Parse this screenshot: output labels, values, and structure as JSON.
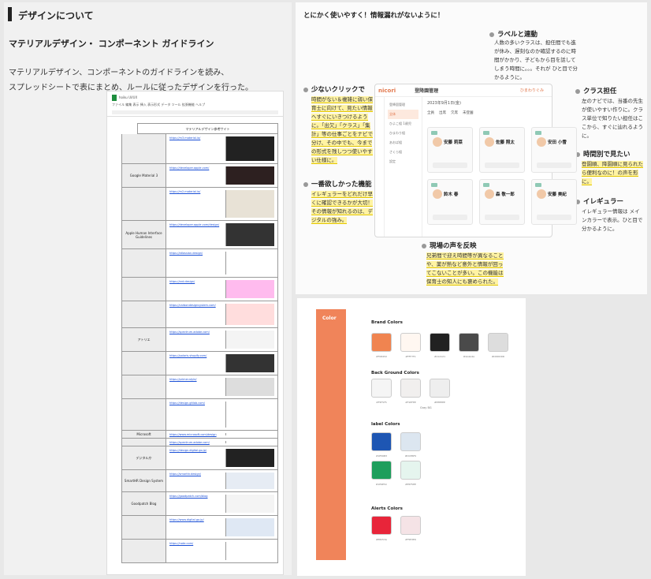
{
  "left": {
    "section_title": "デザインについて",
    "subtitle": "マテリアルデザイン・ コンポーネント ガイドライン",
    "desc_line1": "マテリアルデザイン、コンポーネントのガイドラインを読み、",
    "desc_line2": "スプレッドシートで表にまとめ、ルールに従ったデザインを行った。",
    "sheet": {
      "file_title": "hoiku UI/UX",
      "menu": "ファイル 編集 表示 挿入 表示形式 データ ツール 拡張機能 ヘルプ",
      "header": "マテリアルデザイン参考サイト",
      "rows": [
        {
          "cat": "",
          "link": "https://m3.material.io/"
        },
        {
          "cat": "Google Material 3",
          "link": "https://developer.apple.com/"
        },
        {
          "cat": "",
          "link": "https://m2.material.io/"
        },
        {
          "cat": "Apple Human Interface Guidelines",
          "link": "https://developer.apple.com/design/"
        },
        {
          "cat": "",
          "link": "https://atlassian.design/"
        },
        {
          "cat": "",
          "link": "https://ant.design/"
        },
        {
          "cat": "",
          "link": "https://carbondesignsystem.com/"
        },
        {
          "cat": "アトリエ",
          "link": "https://spectrum.adobe.com/"
        },
        {
          "cat": "",
          "link": "https://polaris.shopify.com/"
        },
        {
          "cat": "",
          "link": "https://primer.style/"
        },
        {
          "cat": "",
          "link": "https://design.gitlab.com/"
        },
        {
          "cat": "Microsoft",
          "link": "https://www.microsoft.com/design"
        },
        {
          "cat": "",
          "link": "https://spectrum.adobe.com/"
        },
        {
          "cat": "デジタル庁",
          "link": "https://design.digital.go.jp/"
        },
        {
          "cat": "SmartHR Design System",
          "link": "https://smarthr.design/"
        },
        {
          "cat": "Goodpatch Blog",
          "link": "https://goodpatch.com/blog"
        },
        {
          "cat": "",
          "link": "https://www.digital.go.jp/"
        },
        {
          "cat": "",
          "link": "https://note.com/"
        }
      ]
    }
  },
  "topright": {
    "heading": "とにかく使いやすく！情報漏れがないように！",
    "annotations": [
      {
        "title": "ラベルと連動",
        "text": "人数の多いクラスは、担任間でも進が休み、遅刻なのか確認するのに時間がかかり、子どもから目を話してしまう時間に。。。それが ひと目で分かるように。"
      },
      {
        "title": "少ないクリックで",
        "text": "時間がない＆複雑に弱い保育士に向けて、見たい情報へすぐにいきつけるように。「出欠」「クラス」「集計」等の仕事ごとをナビで分け、その中でも、今までの形式を残しつつ使いやすい仕様に。"
      },
      {
        "title": "クラス担任",
        "text": "左のナビでは、当番の先生が使いやすい作りに。クラス単位で知りたい担任はここから、すぐに辿れるように。"
      },
      {
        "title": "時間別で見たい",
        "text": "登園順、降園順に見られたら便利なのに！の声を形に。"
      },
      {
        "title": "一番欲しかった機能",
        "text": "イレギュラーをどれだけ早くに確認できるかが大切！その情報が知れるのは、デジタルの強み。"
      },
      {
        "title": "イレギュラー",
        "text": "イレギュラー情報は メインカラーで表示。ひと目で分かるように。"
      },
      {
        "title": "現場の声を反映",
        "text": "兄弟間で迎え時間等が異なることや、薬が熱など意外と情報が回ってこないことが多い。この機能は保育士の知人にも褒められた。"
      }
    ],
    "app": {
      "brand": "nicori",
      "title": "登降園管理",
      "user": "ひまわりぐみ",
      "date": "2023年9月1日(金)",
      "tabs": [
        "全員",
        "出席",
        "欠席",
        "未登園"
      ],
      "nav": [
        "登降園管理",
        "全体",
        "ひよこ組 1歳児",
        "ひまわり組",
        "あおば組",
        "さくら組",
        "設定"
      ],
      "children": [
        "安藤 莉菜",
        "佐藤 照太",
        "安田 小雪",
        "鈴木 春",
        "森 敬一郎",
        "安藤 美紀"
      ]
    }
  },
  "palette": {
    "label": "Color",
    "brand_title": "Brand Colors",
    "brand": [
      {
        "hex": "#F08450",
        "label": "#F08450"
      },
      {
        "hex": "#FFF7F1",
        "label": "#FFF7F1"
      },
      {
        "hex": "#212121",
        "label": "#212121"
      },
      {
        "hex": "#4A4A4A",
        "label": "#4A4A4A"
      },
      {
        "hex": "#DDDDDD",
        "label": "#DDDDDD"
      }
    ],
    "bg_title": "Back Ground Colors",
    "bg": [
      {
        "hex": "#F5F5F5",
        "label": "#F5F5F5"
      },
      {
        "hex": "#F1EFEE",
        "label": "#F1EFEE"
      },
      {
        "hex": "#EEEEEE",
        "label": "#EEEEEE"
      }
    ],
    "bg_note": "Gray BG",
    "label_title": "label Colors",
    "labels": [
      {
        "hex": "#1E56B3",
        "label": "#1E56B3"
      },
      {
        "hex": "#DCE6F0",
        "label": "#DCE6F0"
      },
      {
        "hex": "#1E9E5C",
        "label": "#1E9E5C"
      },
      {
        "hex": "#E5F5EE",
        "label": "#E5F5EE"
      }
    ],
    "alert_title": "Alerts Colors",
    "alerts": [
      {
        "hex": "#E8253A",
        "label": "#E8253A"
      },
      {
        "hex": "#F5E3E6",
        "label": "#F5E3E6"
      }
    ]
  }
}
